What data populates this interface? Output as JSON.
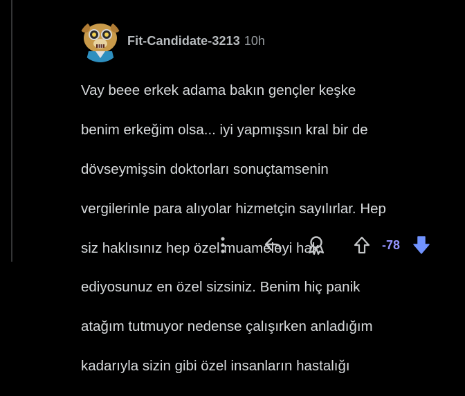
{
  "comment": {
    "author": "Fit-Candidate-3213",
    "time_ago": "10h",
    "lines": [
      "Vay beee erkek adama bakın gençler keşke",
      "benim erkeğim olsa... iyi yapmışsın kral bir de",
      "dövseymişsin doktorları sonuçtamsenin",
      "vergilerinle para alıyolar hizmetçin sayılırlar. Hep",
      "siz haklısınız hep özel muameleyi hak",
      "ediyosunuz en özel sizsiniz. Benim hiç panik",
      "atağım tutmuyor nedense çalışırken anladığım",
      "kadarıyla sizin gibi özel insanların hastalığı"
    ]
  },
  "actions": {
    "more_icon": "more-vertical-icon",
    "reply_icon": "reply-icon",
    "award_icon": "award-icon",
    "upvote_icon": "upvote-icon",
    "downvote_icon": "downvote-icon",
    "vote_count": "-78"
  },
  "colors": {
    "background": "#000000",
    "text": "#d7dadc",
    "meta": "#9a9fa3",
    "downvote_accent": "#7193ff",
    "vote_count": "#9494ff"
  }
}
